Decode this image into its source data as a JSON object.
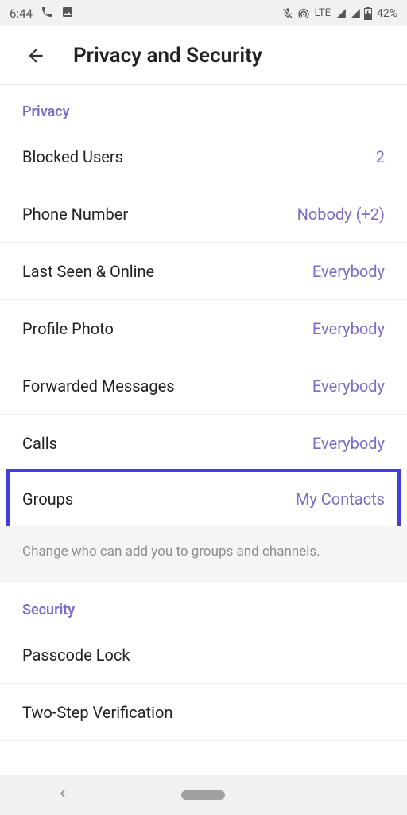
{
  "status_bar": {
    "time": "6:44",
    "network": "LTE",
    "battery": "42%"
  },
  "header": {
    "title": "Privacy and Security"
  },
  "sections": {
    "privacy": {
      "title": "Privacy",
      "items": [
        {
          "label": "Blocked Users",
          "value": "2"
        },
        {
          "label": "Phone Number",
          "value": "Nobody (+2)"
        },
        {
          "label": "Last Seen & Online",
          "value": "Everybody"
        },
        {
          "label": "Profile Photo",
          "value": "Everybody"
        },
        {
          "label": "Forwarded Messages",
          "value": "Everybody"
        },
        {
          "label": "Calls",
          "value": "Everybody"
        },
        {
          "label": "Groups",
          "value": "My Contacts"
        }
      ],
      "note": "Change who can add you to groups and channels."
    },
    "security": {
      "title": "Security",
      "items": [
        {
          "label": "Passcode Lock"
        },
        {
          "label": "Two-Step Verification"
        }
      ]
    }
  }
}
